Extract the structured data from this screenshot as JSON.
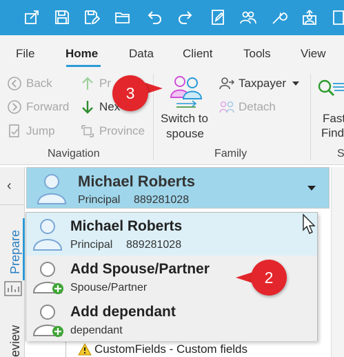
{
  "quick_access": {
    "icons": [
      "export-icon",
      "save-icon",
      "save-edit-icon",
      "open-folder-icon",
      "undo-icon",
      "redo-icon",
      "form-edit-icon",
      "people-icon",
      "tools-icon",
      "upload-user-icon",
      "building-icon"
    ]
  },
  "menu": {
    "tabs": [
      {
        "label": "File",
        "active": false
      },
      {
        "label": "Home",
        "active": true
      },
      {
        "label": "Data",
        "active": false
      },
      {
        "label": "Client",
        "active": false
      },
      {
        "label": "Tools",
        "active": false
      },
      {
        "label": "View",
        "active": false
      }
    ]
  },
  "ribbon": {
    "navigation": {
      "label": "Navigation",
      "back": "Back",
      "forward": "Forward",
      "jump": "Jump",
      "prev": "Pr",
      "next": "Nex",
      "province": "Province"
    },
    "family": {
      "label": "Family",
      "switch_line1": "Switch to",
      "switch_line2": "spouse",
      "taxpayer": "Taxpayer",
      "detach": "Detach"
    },
    "fast": {
      "line1": "Fast",
      "line2": "Find",
      "group_label": "S"
    }
  },
  "left_rail": {
    "collapse_glyph": "‹",
    "tab_prepare": "Prepare",
    "tab_review": "eview"
  },
  "client_header": {
    "name": "Michael Roberts",
    "role": "Principal",
    "id": "889281028"
  },
  "dropdown": {
    "items": [
      {
        "name": "Michael Roberts",
        "role": "Principal",
        "id": "889281028",
        "has_plus": false
      },
      {
        "name": "Add Spouse/Partner",
        "role": "Spouse/Partner",
        "has_plus": true
      },
      {
        "name": "Add dependant",
        "role": "dependant",
        "has_plus": true
      }
    ]
  },
  "tree": {
    "row_text": "CustomFields - Custom fields"
  },
  "callouts": {
    "one": "3",
    "two": "2"
  },
  "colors": {
    "accent": "#2a9bd7",
    "header_bar": "#9fd6eb",
    "badge": "#e3262b",
    "avatar_stroke": "#7aa7d6",
    "spouse_icon_pink": "#d14fd8",
    "plus_green": "#3fa535"
  }
}
